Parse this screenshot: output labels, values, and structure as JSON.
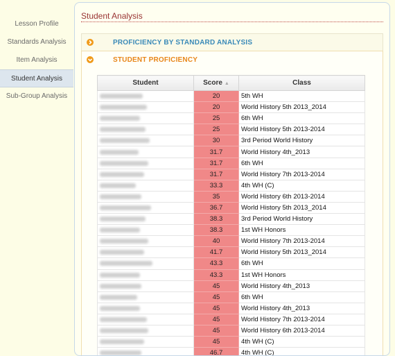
{
  "sidebar": {
    "items": [
      {
        "label": "Lesson Profile"
      },
      {
        "label": "Standards Analysis"
      },
      {
        "label": "Item Analysis"
      },
      {
        "label": "Student Analysis"
      },
      {
        "label": "Sub-Group Analysis"
      }
    ],
    "active_index": 3
  },
  "panel": {
    "title": "Student Analysis",
    "sections": [
      {
        "label": "PROFICIENCY BY STANDARD ANALYSIS",
        "expanded": false
      },
      {
        "label": "STUDENT PROFICIENCY",
        "expanded": true
      }
    ]
  },
  "table": {
    "headers": {
      "student": "Student",
      "score": "Score",
      "class": "Class"
    },
    "rows": [
      {
        "score": "20",
        "class": "5th WH"
      },
      {
        "score": "20",
        "class": "World History 5th 2013_2014"
      },
      {
        "score": "25",
        "class": "6th WH"
      },
      {
        "score": "25",
        "class": "World History 5th 2013-2014"
      },
      {
        "score": "30",
        "class": "3rd Period World History"
      },
      {
        "score": "31.7",
        "class": "World History 4th_2013"
      },
      {
        "score": "31.7",
        "class": "6th WH"
      },
      {
        "score": "31.7",
        "class": "World History 7th 2013-2014"
      },
      {
        "score": "33.3",
        "class": "4th WH (C)"
      },
      {
        "score": "35",
        "class": "World History 6th 2013-2014"
      },
      {
        "score": "36.7",
        "class": "World History 5th 2013_2014"
      },
      {
        "score": "38.3",
        "class": "3rd Period World History"
      },
      {
        "score": "38.3",
        "class": "1st WH Honors"
      },
      {
        "score": "40",
        "class": "World History 7th 2013-2014"
      },
      {
        "score": "41.7",
        "class": "World History 5th 2013_2014"
      },
      {
        "score": "43.3",
        "class": "6th WH"
      },
      {
        "score": "43.3",
        "class": "1st WH Honors"
      },
      {
        "score": "45",
        "class": "World History 4th_2013"
      },
      {
        "score": "45",
        "class": "6th WH"
      },
      {
        "score": "45",
        "class": "World History 4th_2013"
      },
      {
        "score": "45",
        "class": "World History 7th 2013-2014"
      },
      {
        "score": "45",
        "class": "World History 6th 2013-2014"
      },
      {
        "score": "45",
        "class": "4th WH (C)"
      },
      {
        "score": "46.7",
        "class": "4th WH (C)"
      }
    ]
  },
  "colors": {
    "score_fill": "#f08888",
    "accent": "#f09a1a",
    "title": "#993333"
  },
  "icons": {
    "expand": "chevron-right-icon",
    "collapse": "chevron-down-icon",
    "sort": "sort-asc-icon"
  }
}
